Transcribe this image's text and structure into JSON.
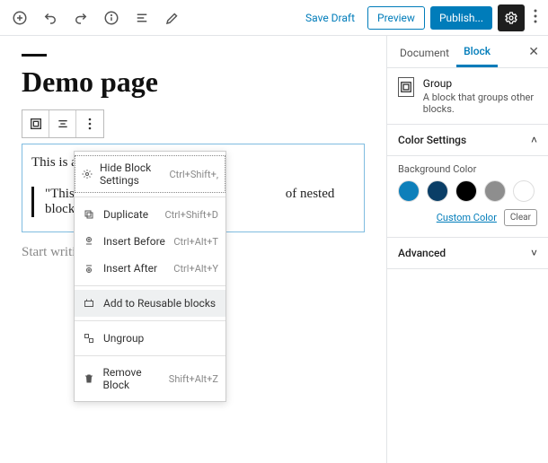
{
  "topbar": {
    "save_draft": "Save Draft",
    "preview": "Preview",
    "publish": "Publish..."
  },
  "editor": {
    "page_title": "Demo page",
    "paragraph1": "This is a p",
    "quote_text": "\"This is",
    "quote_rest": " of nested block :)",
    "placeholder": "Start writi"
  },
  "ctx": {
    "hide_settings": {
      "label": "Hide Block Settings",
      "shortcut": "Ctrl+Shift+,"
    },
    "duplicate": {
      "label": "Duplicate",
      "shortcut": "Ctrl+Shift+D"
    },
    "insert_before": {
      "label": "Insert Before",
      "shortcut": "Ctrl+Alt+T"
    },
    "insert_after": {
      "label": "Insert After",
      "shortcut": "Ctrl+Alt+Y"
    },
    "add_reusable": {
      "label": "Add to Reusable blocks"
    },
    "ungroup": {
      "label": "Ungroup"
    },
    "remove": {
      "label": "Remove Block",
      "shortcut": "Shift+Alt+Z"
    }
  },
  "sidebar": {
    "tabs": {
      "document": "Document",
      "block": "Block"
    },
    "block_info": {
      "name": "Group",
      "desc": "A block that groups other blocks."
    },
    "color_panel": {
      "title": "Color Settings",
      "bg_label": "Background Color"
    },
    "swatches": [
      "#0d7fba",
      "#0a3e66",
      "#000000",
      "#8e8e8e",
      "#ffffff"
    ],
    "custom_color": "Custom Color",
    "clear": "Clear",
    "advanced": "Advanced"
  }
}
